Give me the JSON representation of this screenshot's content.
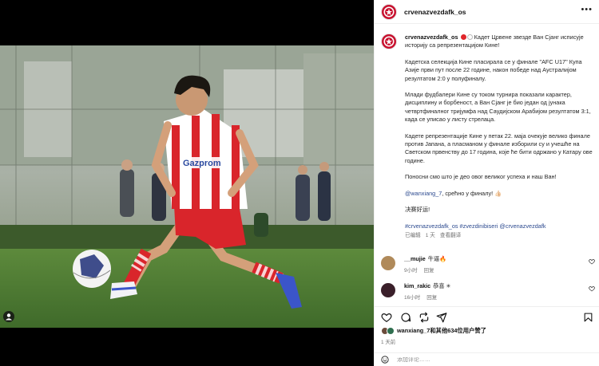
{
  "post": {
    "username": "crvenazvezdafk_os",
    "more_label": "•••",
    "caption": {
      "intro": "Кадет Црвене звезде Ван Сјанг исписује историју са репрезентацијом Кине!",
      "p1": "Кадетска селекција Кине пласирала се у финале \"AFC U17\" Купа Азије први пут после 22 године, након победе над Аустралијом резултатом 2:0 у полуфиналу.",
      "p2": "Млади фудбалери Кине су током турнира показали карактер, дисциплину и борбеност, а Ван Сјанг је био један од јунака четвртфиналног тријумфа над Саудијском Арабијом резултатом 3:1, када се уписао у листу стрелаца.",
      "p3": "Кадете репрезентације Кине у петак 22. маја очекује велико финале против Јапана, а пласманом у финале изборили су и учешће на Светском првенству до 17 година, које ће бити одржано у Катару ове године.",
      "p4": "Поносни смо што је део овог великог успеха и наш Ван!",
      "mention": "@wanxiang_7",
      "p5_rest": ", срећно у финалу! 👍🏻",
      "p6": "决赛好运!",
      "hashtags": "#crvenazvezdafk_os #zvezdinibiseri @crvenazvezdafk",
      "edited": "已编辑",
      "age": "1 天",
      "see_translation": "查看翻译"
    },
    "comments": [
      {
        "username": "__mujie",
        "text": "牛逼🔥",
        "time": "9小时",
        "reply": "回复",
        "avatar_color": "#b08a5a"
      },
      {
        "username": "kim_rakic",
        "text": "恭喜 ✳",
        "time": "16小时",
        "reply": "回复",
        "avatar_color": "#3a1f2a"
      }
    ],
    "likes_text": "wanxiang_7和其他634位用户赞了",
    "post_age": "1 天前",
    "add_comment_placeholder": "添加评论……",
    "colors": {
      "brand_red": "#c8102e",
      "link": "#2c4a8f",
      "muted": "#737373"
    },
    "icons": [
      "heart-icon",
      "comment-icon",
      "repost-icon",
      "share-icon",
      "bookmark-icon",
      "smile-icon",
      "user-tag-icon",
      "more-icon"
    ]
  }
}
